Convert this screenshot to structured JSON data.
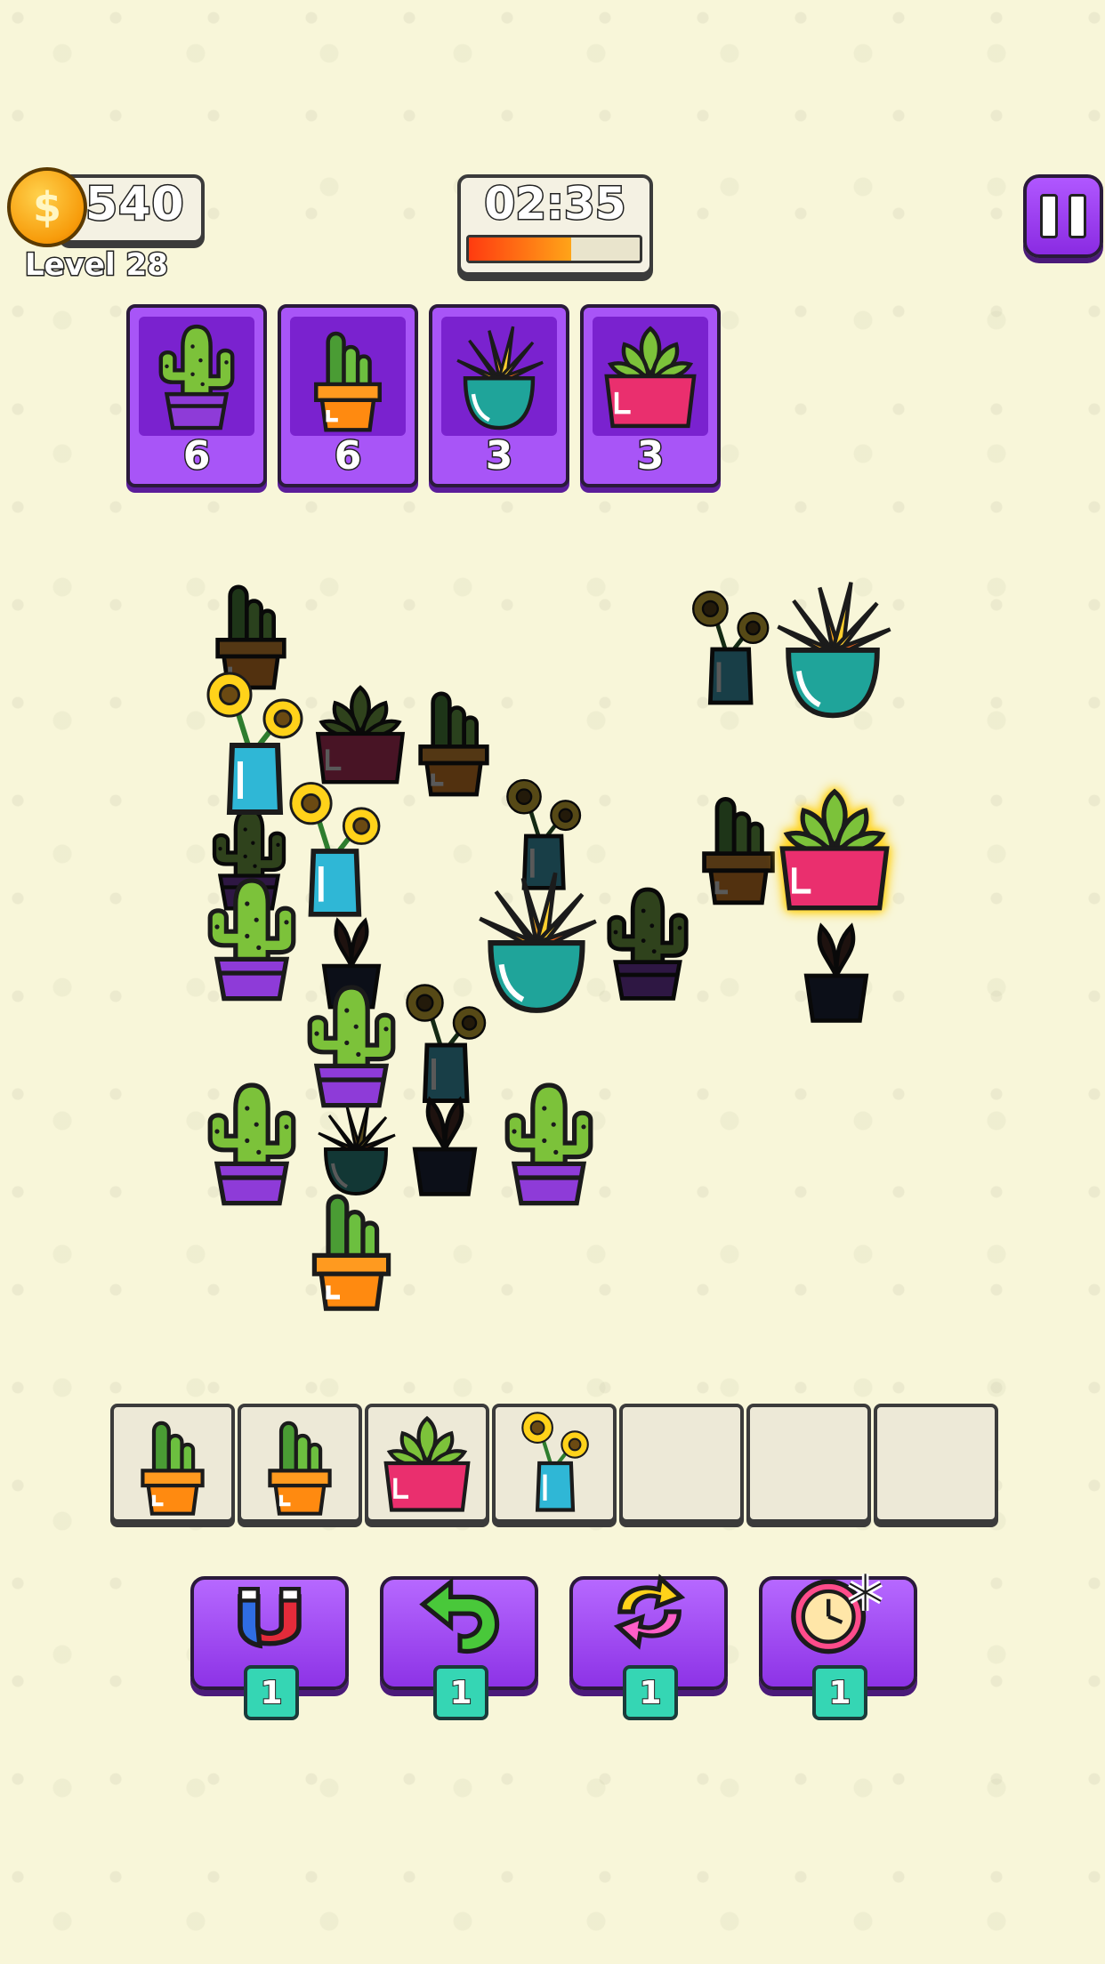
{
  "hud": {
    "coins": "540",
    "level": "Level 28",
    "timer": "02:35",
    "timer_progress": 0.6
  },
  "goals": [
    {
      "item": "green-cactus-purple-pot",
      "count": "6"
    },
    {
      "item": "tall-cactus-orange-pot",
      "count": "6"
    },
    {
      "item": "spiky-plant-teal-pot",
      "count": "3"
    },
    {
      "item": "succulent-pink-pot",
      "count": "3"
    }
  ],
  "tray": [
    {
      "item": "tall-cactus-orange-pot"
    },
    {
      "item": "tall-cactus-orange-pot"
    },
    {
      "item": "succulent-pink-pot"
    },
    {
      "item": "sunflower-blue-vase"
    },
    {
      "item": ""
    },
    {
      "item": ""
    },
    {
      "item": ""
    }
  ],
  "powerups": [
    {
      "name": "magnet",
      "count": "1"
    },
    {
      "name": "undo",
      "count": "1"
    },
    {
      "name": "shuffle",
      "count": "1"
    },
    {
      "name": "freeze-time",
      "count": "1"
    }
  ],
  "colors": {
    "purple": "#a855f7",
    "purple_dark": "#7a22cf",
    "teal": "#35d6b4",
    "background": "#f8f6d9"
  }
}
